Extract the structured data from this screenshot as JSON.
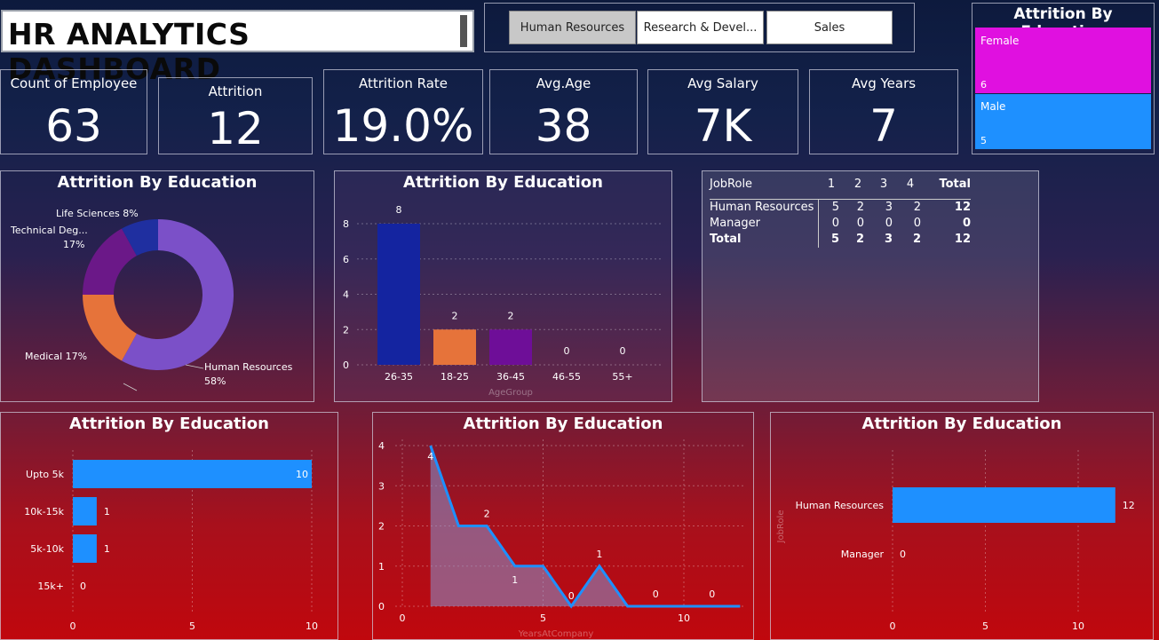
{
  "header": {
    "title": "HR ANALYTICS DASHBOARD",
    "slicers": [
      {
        "label": "Human Resources",
        "selected": true
      },
      {
        "label": "Research & Devel...",
        "selected": false
      },
      {
        "label": "Sales",
        "selected": false
      }
    ]
  },
  "kpis": [
    {
      "label": "Count of Employee",
      "value": "63"
    },
    {
      "label": "Attrition",
      "value": "12"
    },
    {
      "label": "Attrition Rate",
      "value": "19.0%"
    },
    {
      "label": "Avg.Age",
      "value": "38"
    },
    {
      "label": "Avg Salary",
      "value": "7K"
    },
    {
      "label": "Avg Years",
      "value": "7"
    }
  ],
  "gender_treemap": {
    "title": "Attrition By Education",
    "items": [
      {
        "label": "Female",
        "value": "6",
        "color": "#e010e0"
      },
      {
        "label": "Male",
        "value": "5",
        "color": "#1e90ff"
      }
    ]
  },
  "donut": {
    "title": "Attrition By Education",
    "labels": {
      "life": "Life Sciences 8%",
      "tech1": "Technical Deg...",
      "tech2": "17%",
      "medical": "Medical 17%",
      "hr1": "Human Resources",
      "hr2": "58%"
    }
  },
  "age_chart": {
    "title": "Attrition By Education",
    "xlabel": "AgeGroup",
    "yticks": [
      "0",
      "2",
      "4",
      "6",
      "8"
    ],
    "categories": [
      "26-35",
      "18-25",
      "36-45",
      "46-55",
      "55+"
    ],
    "values": [
      "8",
      "2",
      "2",
      "0",
      "0"
    ]
  },
  "matrix": {
    "header": [
      "JobRole",
      "1",
      "2",
      "3",
      "4",
      "Total"
    ],
    "rows": [
      [
        "Human Resources",
        "5",
        "2",
        "3",
        "2",
        "12"
      ],
      [
        "Manager",
        "0",
        "0",
        "0",
        "0",
        "0"
      ]
    ],
    "total": [
      "Total",
      "5",
      "2",
      "3",
      "2",
      "12"
    ]
  },
  "salary_chart": {
    "title": "Attrition By Education",
    "categories": [
      "Upto 5k",
      "10k-15k",
      "5k-10k",
      "15k+"
    ],
    "values": [
      "10",
      "1",
      "1",
      "0"
    ],
    "xticks": [
      "0",
      "5",
      "10"
    ]
  },
  "years_chart": {
    "title": "Attrition By Education",
    "xlabel": "YearsAtCompany",
    "yticks": [
      "0",
      "1",
      "2",
      "3",
      "4"
    ],
    "xticks": [
      "0",
      "5",
      "10"
    ],
    "labels": [
      "4",
      "2",
      "1",
      "0",
      "1",
      "0",
      "0"
    ]
  },
  "jobrole_chart": {
    "title": "Attrition By Education",
    "ylabel": "JobRole",
    "categories": [
      "Human Resources",
      "Manager"
    ],
    "values": [
      "12",
      "0"
    ],
    "xticks": [
      "0",
      "5",
      "10"
    ]
  },
  "chart_data": [
    {
      "type": "pie",
      "title": "Attrition By Education",
      "categories": [
        "Human Resources",
        "Medical",
        "Technical Degree",
        "Life Sciences"
      ],
      "values": [
        58,
        17,
        17,
        8
      ]
    },
    {
      "type": "bar",
      "title": "Attrition By Education",
      "xlabel": "AgeGroup",
      "categories": [
        "26-35",
        "18-25",
        "36-45",
        "46-55",
        "55+"
      ],
      "values": [
        8,
        2,
        2,
        0,
        0
      ],
      "ylim": [
        0,
        8
      ]
    },
    {
      "type": "bar",
      "title": "Attrition By Education",
      "categories": [
        "Upto 5k",
        "10k-15k",
        "5k-10k",
        "15k+"
      ],
      "values": [
        10,
        1,
        1,
        0
      ],
      "xlim": [
        0,
        10
      ]
    },
    {
      "type": "area",
      "title": "Attrition By Education",
      "xlabel": "YearsAtCompany",
      "x": [
        1,
        2,
        3,
        4,
        5,
        6,
        7,
        8,
        9,
        10,
        11,
        12
      ],
      "values": [
        4,
        2,
        2,
        1,
        1,
        0,
        1,
        0,
        0,
        0,
        0,
        0
      ],
      "ylim": [
        0,
        4
      ]
    },
    {
      "type": "bar",
      "title": "Attrition By Education",
      "ylabel": "JobRole",
      "categories": [
        "Human Resources",
        "Manager"
      ],
      "values": [
        12,
        0
      ],
      "xlim": [
        0,
        12
      ]
    }
  ]
}
